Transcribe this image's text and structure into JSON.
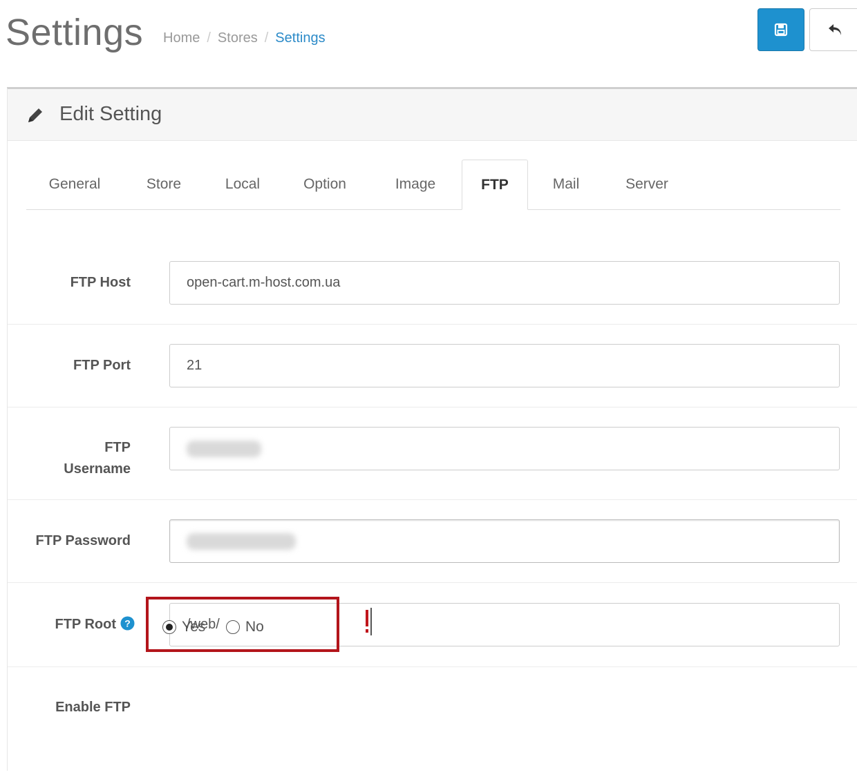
{
  "header": {
    "title": "Settings",
    "breadcrumb": [
      {
        "label": "Home"
      },
      {
        "label": "Stores"
      },
      {
        "label": "Settings"
      }
    ],
    "icons": {
      "save": "save-icon",
      "back": "reply-icon"
    },
    "colors": {
      "save_button": "#1e91cf",
      "breadcrumb_active": "#2b8ac8"
    }
  },
  "panel": {
    "title": "Edit Setting",
    "icon": "pencil-icon"
  },
  "tabs": [
    {
      "label": "General"
    },
    {
      "label": "Store"
    },
    {
      "label": "Local"
    },
    {
      "label": "Option"
    },
    {
      "label": "Image"
    },
    {
      "label": "FTP",
      "active": true
    },
    {
      "label": "Mail"
    },
    {
      "label": "Server"
    }
  ],
  "form": {
    "ftp_host": {
      "label": "FTP Host",
      "value": "open-cart.m-host.com.ua"
    },
    "ftp_port": {
      "label": "FTP Port",
      "value": "21"
    },
    "ftp_username": {
      "label_line1": "FTP",
      "label_line2": "Username"
    },
    "ftp_password": {
      "label": "FTP Password"
    },
    "ftp_root": {
      "label": "FTP Root",
      "value": "/web/",
      "help_icon": "question-circle-icon"
    },
    "enable_ftp": {
      "label": "Enable FTP",
      "options": [
        {
          "label": "Yes",
          "checked": true
        },
        {
          "label": "No",
          "checked": false
        }
      ],
      "highlight_color": "#b3151b"
    }
  }
}
